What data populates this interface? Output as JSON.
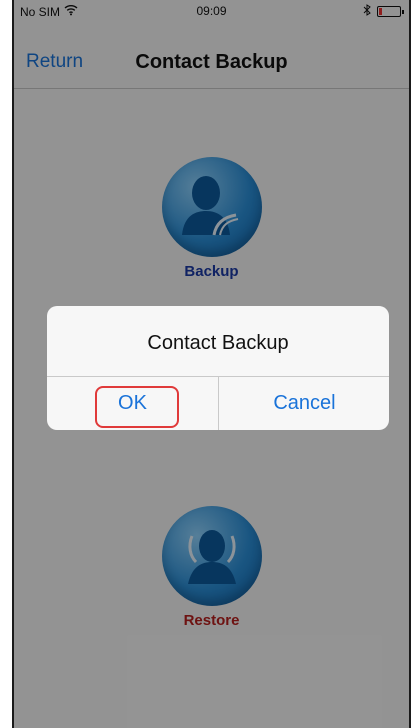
{
  "status": {
    "carrier": "No SIM",
    "time": "09:09"
  },
  "nav": {
    "back_label": "Return",
    "title": "Contact Backup"
  },
  "actions": {
    "backup_label": "Backup",
    "restore_label": "Restore"
  },
  "alert": {
    "title": "Contact Backup",
    "ok_label": "OK",
    "cancel_label": "Cancel"
  },
  "colors": {
    "accent": "#1a73d9",
    "backup_label": "#1b3aa6",
    "restore_label": "#b7211f",
    "highlight": "#e03a3a"
  },
  "icons": {
    "wifi": "wifi-icon",
    "bluetooth": "bluetooth-icon",
    "battery": "battery-icon",
    "backup": "contact-backup-icon",
    "restore": "contact-restore-icon"
  }
}
